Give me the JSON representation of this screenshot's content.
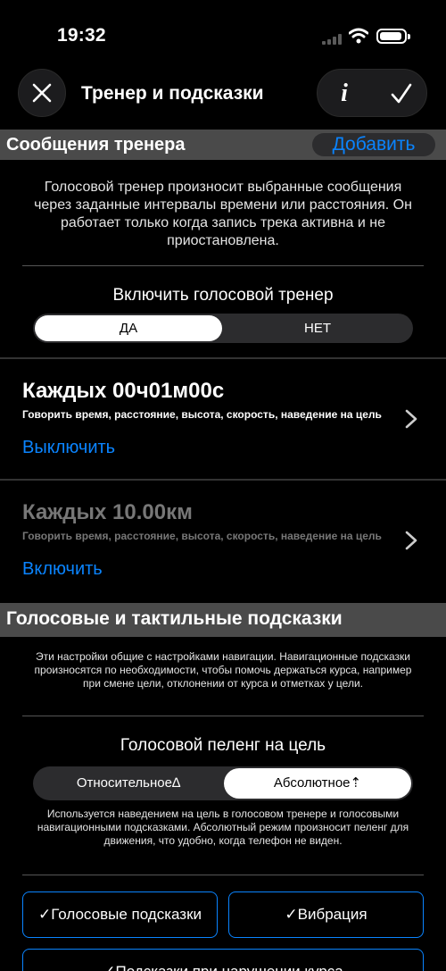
{
  "status_bar": {
    "time": "19:32"
  },
  "nav": {
    "title": "Тренер и подсказки",
    "info_label": "i"
  },
  "coach": {
    "header": "Сообщения тренера",
    "add_label": "Добавить",
    "description": "Голосовой тренер произносит выбранные сообщения через заданные интервалы времени или расстояния. Он работает только когда запись трека активна и не приостановлена.",
    "enable_label": "Включить голосовой тренер",
    "yes": "ДА",
    "no": "НЕТ",
    "items": [
      {
        "title": "Каждых 00ч01м00с",
        "subtitle": "Говорить время, расстояние, высота, скорость, наведение на цель",
        "action": "Выключить"
      },
      {
        "title": "Каждых 10.00км",
        "subtitle": "Говорить время, расстояние, высота, скорость, наведение на цель",
        "action": "Включить"
      }
    ]
  },
  "hints": {
    "header": "Голосовые и тактильные подсказки",
    "description": "Эти настройки общие с настройками навигации. Навигационные подсказки произносятся по необходимости, чтобы помочь держаться курса, например при смене цели, отклонении от курса и отметках у цели.",
    "bearing_label": "Голосовой пеленг на цель",
    "relative": "Относительное∆",
    "absolute": "Абсолютное⇡",
    "bearing_description": "Используется наведением на цель в голосовом тренере и голосовыми навигационными подсказками. Абсолютный режим произносит пеленг для движения, что удобно, когда телефон не виден.",
    "voice_button": "✓Голосовые подсказки",
    "vibration_button": "✓Вибрация",
    "offcourse_button": "✓Подсказки при нарушении курса"
  },
  "colors": {
    "accent": "#0a84ff",
    "section_header": "#4a4a4a",
    "background": "#000000"
  }
}
